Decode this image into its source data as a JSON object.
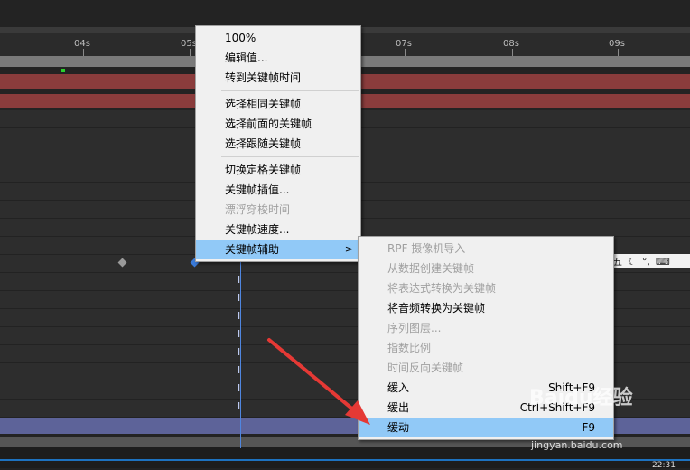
{
  "timeline": {
    "ticks": [
      "04s",
      "05s",
      "07s",
      "08s",
      "09s"
    ]
  },
  "ime_toolbar": {
    "char": "五",
    "icons": [
      "moon-icon",
      "dot-icon",
      "keyboard-icon"
    ]
  },
  "context_menu": {
    "items": [
      {
        "label": "100%",
        "disabled": false
      },
      {
        "label": "编辑值...",
        "disabled": false
      },
      {
        "label": "转到关键帧时间",
        "disabled": false
      },
      {
        "label": "选择相同关键帧",
        "disabled": false
      },
      {
        "label": "选择前面的关键帧",
        "disabled": false
      },
      {
        "label": "选择跟随关键帧",
        "disabled": false
      },
      {
        "label": "切换定格关键帧",
        "disabled": false
      },
      {
        "label": "关键帧插值...",
        "disabled": false
      },
      {
        "label": "漂浮穿梭时间",
        "disabled": true
      },
      {
        "label": "关键帧速度...",
        "disabled": false
      },
      {
        "label": "关键帧辅助",
        "disabled": false,
        "highlighted": true,
        "submenu_arrow": ">"
      }
    ]
  },
  "submenu": {
    "items": [
      {
        "label": "RPF 摄像机导入",
        "disabled": true,
        "shortcut": ""
      },
      {
        "label": "从数据创建关键帧",
        "disabled": true,
        "shortcut": ""
      },
      {
        "label": "将表达式转换为关键帧",
        "disabled": true,
        "shortcut": ""
      },
      {
        "label": "将音频转换为关键帧",
        "disabled": false,
        "shortcut": ""
      },
      {
        "label": "序列图层...",
        "disabled": true,
        "shortcut": ""
      },
      {
        "label": "指数比例",
        "disabled": true,
        "shortcut": ""
      },
      {
        "label": "时间反向关键帧",
        "disabled": true,
        "shortcut": ""
      },
      {
        "label": "缓入",
        "disabled": false,
        "shortcut": "Shift+F9"
      },
      {
        "label": "缓出",
        "disabled": false,
        "shortcut": "Ctrl+Shift+F9"
      },
      {
        "label": "缓动",
        "disabled": false,
        "shortcut": "F9",
        "highlighted": true
      }
    ]
  },
  "watermark": {
    "logo": "Baidu经验",
    "url": "jingyan.baidu.com"
  },
  "clock_text": "22:31",
  "colors": {
    "highlight": "#91c9f7",
    "playhead": "#4f86e0",
    "arrow": "#e53935"
  }
}
